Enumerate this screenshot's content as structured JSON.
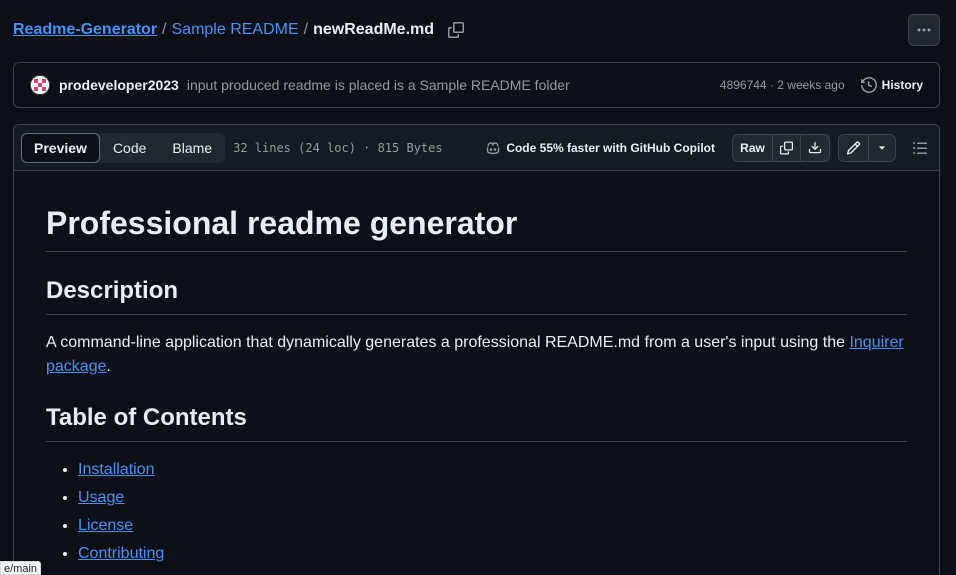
{
  "breadcrumb": {
    "repo": "Readme-Generator",
    "separator": "/",
    "folder": "Sample README",
    "file": "newReadMe.md"
  },
  "icons": {
    "copy_path": "copy-icon",
    "more": "kebab-horizontal-icon",
    "history": "history-icon",
    "copilot": "copilot-icon",
    "copy_raw": "copy-icon",
    "download": "download-icon",
    "edit": "pencil-icon",
    "dropdown": "triangle-down-icon",
    "toc": "list-unordered-icon"
  },
  "commit": {
    "author": "prodeveloper2023",
    "message": "input produced readme is placed is a Sample README folder",
    "meta": "4896744 · 2 weeks ago",
    "history_label": "History"
  },
  "file_header": {
    "tabs": [
      {
        "label": "Preview",
        "active": true
      },
      {
        "label": "Code",
        "active": false
      },
      {
        "label": "Blame",
        "active": false
      }
    ],
    "info": "32 lines (24 loc) · 815 Bytes",
    "copilot_text": "Code 55% faster with GitHub Copilot",
    "raw_label": "Raw"
  },
  "markdown": {
    "h1": "Professional readme generator",
    "description_heading": "Description",
    "description_text": "A command-line application that dynamically generates a professional README.md from a user's input using the ",
    "description_link": "Inquirer package",
    "description_end": ".",
    "toc_heading": "Table of Contents",
    "toc_items": [
      "Installation",
      "Usage",
      "License",
      "Contributing"
    ]
  },
  "status_tip": "e/main",
  "colors": {
    "background": "#0d1117",
    "header_bg": "#151b23",
    "border": "#3d444d",
    "link": "#4493f8",
    "text": "#e6edf3",
    "muted": "#9198a1"
  }
}
